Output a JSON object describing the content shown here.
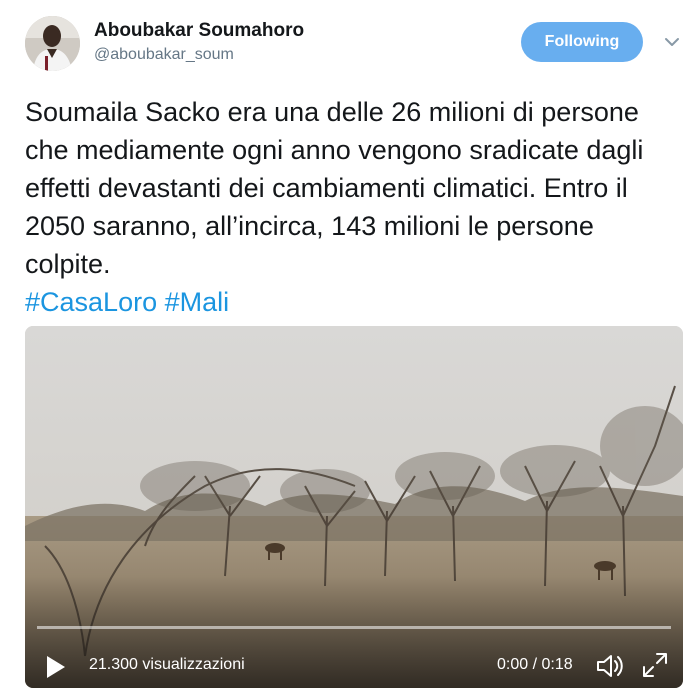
{
  "user": {
    "display_name": "Aboubakar Soumahoro",
    "handle": "@aboubakar_soum"
  },
  "follow_button": {
    "label": "Following"
  },
  "tweet": {
    "text": "Soumaila Sacko era una delle 26 milioni di persone che mediamente ogni anno vengono sradicate dagli effetti devastanti dei cambiamenti climatici. Entro il 2050 saranno, all’incirca, 143 milioni le persone colpite.",
    "hashtags": [
      "#CasaLoro",
      "#Mali"
    ]
  },
  "video": {
    "views": "21.300 visualizzazioni",
    "time": "0:00 / 0:18",
    "progress": 0
  },
  "colors": {
    "accent": "#68aeef",
    "hashtag": "#1b95e0",
    "text": "#14171a",
    "secondary": "#657786"
  },
  "icons": {
    "avatar": "user-photo",
    "chevron": "chevron-down-icon",
    "play": "play-icon",
    "volume": "volume-icon",
    "fullscreen": "fullscreen-icon"
  }
}
